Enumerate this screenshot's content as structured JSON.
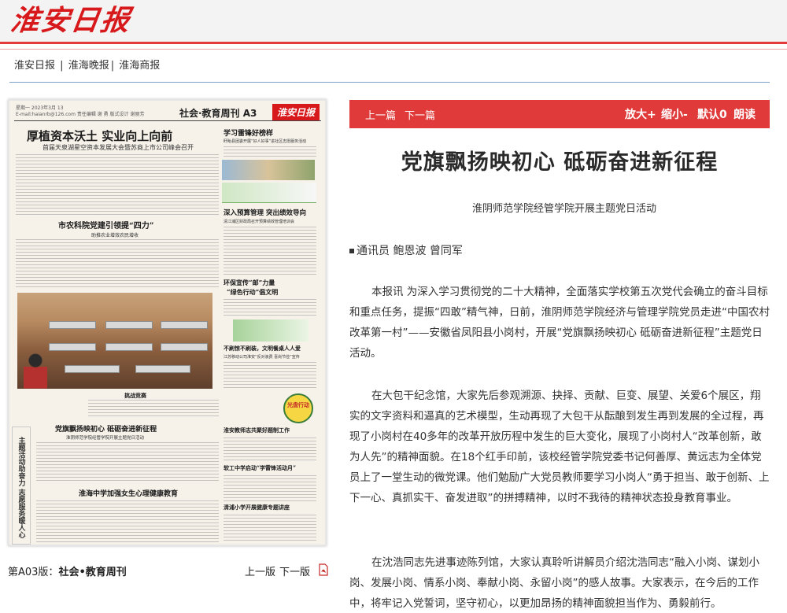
{
  "site": {
    "logo": "淮安日报",
    "links": [
      "淮安日报",
      "淮海晚报",
      "淮海商报"
    ]
  },
  "paper": {
    "date_line": "星期一  2023年3月 13",
    "date_line2": "E-mail:haianrb@126.com   责任编辑 谢  勇   版式设计 谢丽芳",
    "section": "社会·教育周刊  A3",
    "flag": "淮安日报",
    "h1": "厚植资本沃土   实业向上向前",
    "h1_sub": "首届天泉湖星空资本发展大会暨苏商上市公司峰会召开",
    "h2": "市农科院党建引领提“四力”",
    "h2_sub": "助推农业增效农民增收",
    "h3": "学习雷锋好榜样",
    "h3_sub": "盱眙县团委开展“好人好事”进社区志愿服务活动",
    "h4": "深入预算管理   突出绩效导向",
    "h4_sub": "清江浦区财政局召开预算绩效管理培训会",
    "h5": "环保宣传“邮”力量",
    "h5b": "“绿色行动”倡文明",
    "h6": "不刷惊不刷装，文明餐桌人人爱",
    "h6_sub": "江苏移动公司淮安“反对浪费 喜尚节俭”宣传",
    "photo_caption": "挑战竞赛",
    "h7": "党旗飘扬映初心   砥砺奋进新征程",
    "h7_sub": "淮阴师范学院经管学院开展主题党日活动",
    "h8": "淮安教师志共聚好题制工作",
    "h8_sub": "指导着好分会成初心当好班级好年轻精品“课题总结”作品大展",
    "h9": "软工中学启动“学雷锋活动月”",
    "h10": "淮海中学加强女生心理健康教育",
    "h11": "清浦小学开展健康专题讲座",
    "side_label": "教育专递",
    "side_text": "主题活动助奋力   志愿服务暖人心",
    "badge": "光盘行动",
    "edition_label": "第A03版：",
    "edition_name": "社会•教育周刊",
    "prev_page": "上一版",
    "next_page": "下一版"
  },
  "toolbar": {
    "prev": "上一篇",
    "next": "下一篇",
    "bigger": "放大+",
    "smaller": "缩小-",
    "default": "默认0",
    "read": "朗读"
  },
  "article": {
    "title": "党旗飘扬映初心 砥砺奋进新征程",
    "subtitle": "淮阴师范学院经管学院开展主题党日活动",
    "byline": "通讯员 鲍恩波 曾同军",
    "paragraphs": [
      "本报讯 为深入学习贯彻党的二十大精神，全面落实学校第五次党代会确立的奋斗目标和重点任务，提振“四敢”精气神，日前，淮阴师范学院经济与管理学院党员走进“中国农村改革第一村”——安徽省凤阳县小岗村，开展“党旗飘扬映初心 砥砺奋进新征程”主题党日活动。",
      "在大包干纪念馆，大家先后参观溯源、抉择、贡献、巨变、展望、关爱6个展区，翔实的文字资料和逼真的艺术模型，生动再现了大包干从酝酿到发生再到发展的全过程，再现了小岗村在40多年的改革开放历程中发生的巨大变化，展现了小岗村人“改革创新，敢为人先”的精神面貌。在18个红手印前，该校经管学院党委书记何善厚、黄远志为全体党员上了一堂生动的微党课。他们勉励广大党员教师要学习小岗人“勇于担当、敢于创新、上下一心、真抓实干、奋发进取”的拼搏精神，以时不我待的精神状态投身教育事业。",
      "在沈浩同志先进事迹陈列馆，大家认真聆听讲解员介绍沈浩同志“融入小岗、谋划小岗、发展小岗、情系小岗、奉献小岗、永留小岗”的感人故事。大家表示，在今后的工作中，将牢记入党誓词，坚守初心，以更加昂扬的精神面貌担当作为、勇毅前行。"
    ]
  },
  "colors": {
    "brand_red": "#e03a3a",
    "paper_bg": "#f6f2ea",
    "rule_blue": "#7ba0c6"
  }
}
